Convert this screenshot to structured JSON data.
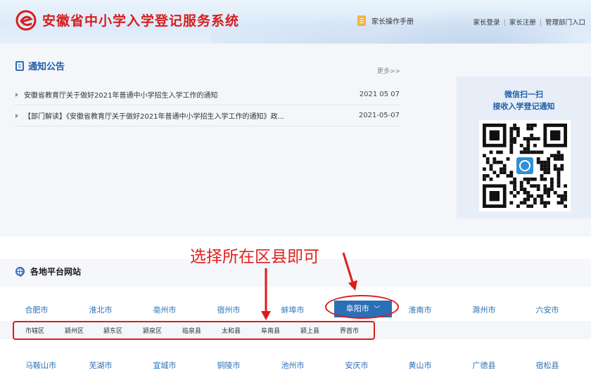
{
  "header": {
    "title": "安徽省中小学入学登记服务系统",
    "manual_label": "家长操作手册",
    "links": [
      "家长登录",
      "家长注册",
      "管理部门入口"
    ]
  },
  "notices": {
    "title": "通知公告",
    "more_label": "更多>>",
    "items": [
      {
        "text": "安徽省教育厅关于做好2021年普通中小学招生入学工作的通知",
        "date": "2021 05 07"
      },
      {
        "text": "【部门解读】《安徽省教育厅关于做好2021年普通中小学招生入学工作的通知》政...",
        "date": "2021-05-07"
      }
    ]
  },
  "qr": {
    "line1": "微信扫一扫",
    "line2": "接收入学登记通知"
  },
  "regional": {
    "title": "各地平台网站",
    "annotation": "选择所在区县即可",
    "row1": [
      "合肥市",
      "淮北市",
      "亳州市",
      "宿州市",
      "蚌埠市",
      "阜阳市",
      "淮南市",
      "滁州市",
      "六安市"
    ],
    "active_city": "阜阳市",
    "districts": [
      "市辖区",
      "颍州区",
      "颍东区",
      "颍泉区",
      "临泉县",
      "太和县",
      "阜南县",
      "颍上县",
      "界首市"
    ],
    "row2": [
      "马鞍山市",
      "芜湖市",
      "宣城市",
      "铜陵市",
      "池州市",
      "安庆市",
      "黄山市",
      "广德县",
      "宿松县"
    ]
  },
  "colors": {
    "brand_red": "#d81e1e",
    "link_blue": "#2b6fb6",
    "annotation_red": "#e01a1a"
  }
}
